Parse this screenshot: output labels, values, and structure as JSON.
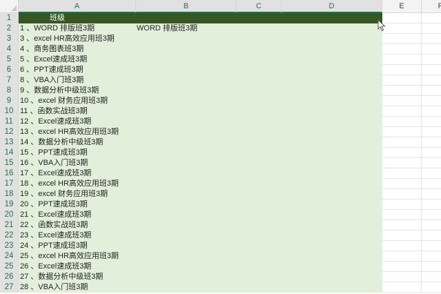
{
  "columns": [
    "A",
    "B",
    "C",
    "D",
    "E",
    "F"
  ],
  "rows": [
    "1",
    "2",
    "3",
    "4",
    "5",
    "6",
    "7",
    "8",
    "9",
    "10",
    "11",
    "12",
    "13",
    "14",
    "15",
    "16",
    "17",
    "18",
    "19",
    "20",
    "21",
    "22",
    "23",
    "24",
    "25",
    "26",
    "27"
  ],
  "header_cell": "班级",
  "b2_value": "WORD 排版班3期",
  "a_values": [
    "1 、WORD 排版班3期",
    "3 、excel HR高效应用班3期",
    "4 、商务图表班3期",
    "5 、Excel速成班3期",
    "6 、PPT速成班3期",
    "8 、VBA入门班3期",
    "9 、数据分析中级班3期",
    "10 、excel 财务应用班3期",
    "11 、函数实战班3期",
    "12 、Excel速成班3期",
    "13 、excel HR高效应用班3期",
    "14 、数据分析中级班3期",
    "15 、PPT速成班3期",
    "16 、VBA入门班3期",
    "17 、Excel速成班3期",
    "18 、excel HR高效应用班3期",
    "19 、excel 财务应用班3期",
    "20 、PPT速成班3期",
    "21 、Excel速成班3期",
    "22 、函数实战班3期",
    "23 、Excel速成班3期",
    "24 、PPT速成班3期",
    "25 、excel HR高效应用班3期",
    "26 、Excel速成班3期",
    "27 、数据分析中级班3期",
    "28 、VBA入门班3期"
  ],
  "colors": {
    "header_fill": "#375623",
    "selection_fill": "#e2efda",
    "accent": "#217346"
  }
}
